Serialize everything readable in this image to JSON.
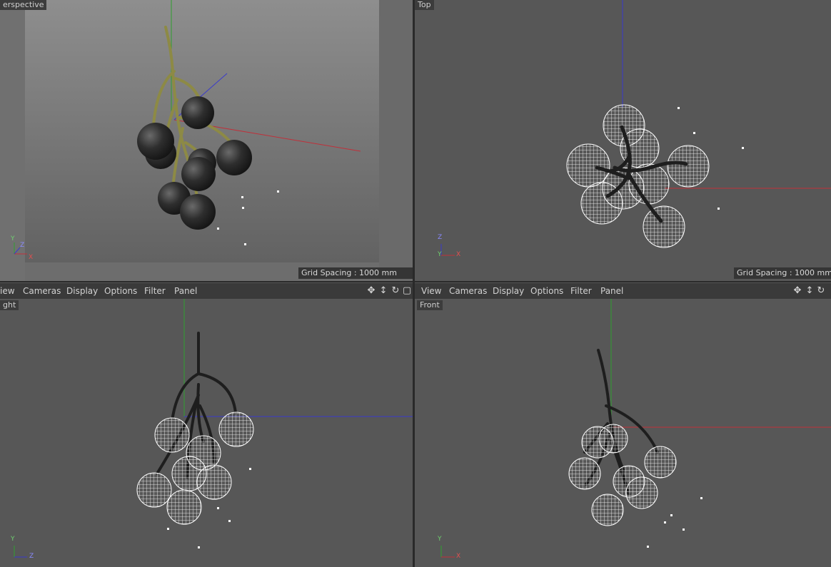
{
  "viewports": {
    "perspective": {
      "label": "erspective",
      "grid": "Grid Spacing : 1000 mm"
    },
    "top": {
      "label": "Top",
      "grid": "Grid Spacing : 1000 mm"
    },
    "right": {
      "label": "ght"
    },
    "front": {
      "label": "Front"
    }
  },
  "menu_left": {
    "view": "iew",
    "cameras": "Cameras",
    "display": "Display",
    "options": "Options",
    "filter": "Filter",
    "panel": "Panel"
  },
  "menu_right": {
    "view": "View",
    "cameras": "Cameras",
    "display": "Display",
    "options": "Options",
    "filter": "Filter",
    "panel": "Panel"
  },
  "axes": {
    "x": "X",
    "y": "Y",
    "z": "Z"
  },
  "colors": {
    "x_axis": "#c0303a",
    "y_axis": "#2fa02f",
    "z_axis": "#3a3acb",
    "viewport_bg": "#575757",
    "wire": "#ffffff"
  },
  "icons": [
    "move-icon",
    "scale-icon",
    "rotate-icon",
    "maximize-icon"
  ]
}
